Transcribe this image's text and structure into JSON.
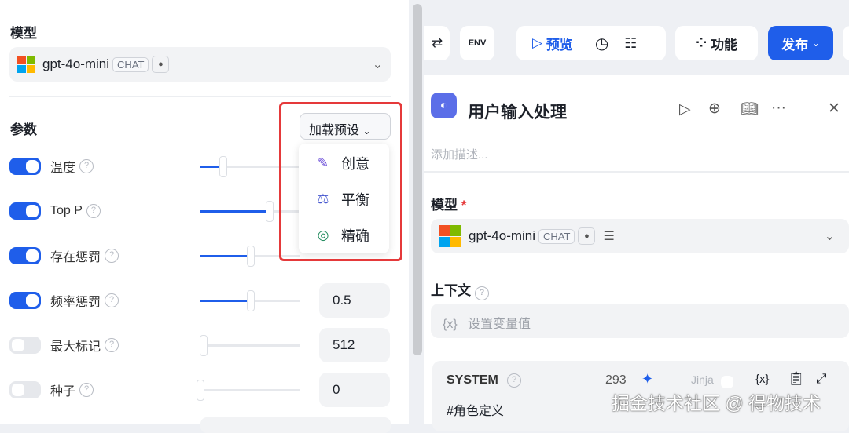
{
  "left_panel": {
    "model_label": "模型",
    "model": {
      "name": "gpt-4o-mini",
      "tag": "CHAT"
    },
    "params_label": "参数",
    "preset_button": "加载预设",
    "preset_menu": [
      {
        "label": "创意",
        "icon": "brush-icon",
        "color": "#6a4cd8"
      },
      {
        "label": "平衡",
        "icon": "scale-icon",
        "color": "#4a5bd0"
      },
      {
        "label": "精确",
        "icon": "target-icon",
        "color": "#1f8a5c"
      }
    ],
    "params": [
      {
        "label": "温度",
        "enabled": true,
        "slider": 0.23,
        "value": null
      },
      {
        "label": "Top P",
        "enabled": true,
        "slider": 0.69,
        "value": null
      },
      {
        "label": "存在惩罚",
        "enabled": true,
        "slider": 0.5,
        "value": null
      },
      {
        "label": "频率惩罚",
        "enabled": true,
        "slider": 0.5,
        "value": "0.5"
      },
      {
        "label": "最大标记",
        "enabled": false,
        "slider": 0.03,
        "value": "512"
      },
      {
        "label": "种子",
        "enabled": false,
        "slider": 0.0,
        "value": "0"
      }
    ]
  },
  "toolbar": {
    "env": "ENV",
    "preview": "预览",
    "features": "功能",
    "publish": "发布"
  },
  "node": {
    "title": "用户输入处理",
    "description_placeholder": "添加描述...",
    "model_label": "模型",
    "required": "*",
    "model": {
      "name": "gpt-4o-mini",
      "tag": "CHAT"
    },
    "context_label": "上下文",
    "context_placeholder": "设置变量值",
    "var_icon": "{x}",
    "system": {
      "label": "SYSTEM",
      "tokens": "293",
      "jinja": "Jinja",
      "content": "#角色定义"
    }
  },
  "watermark": "掘金技术社区 @ 得物技术",
  "colors": {
    "accent": "#1f5eea",
    "highlight": "#e5393a"
  }
}
